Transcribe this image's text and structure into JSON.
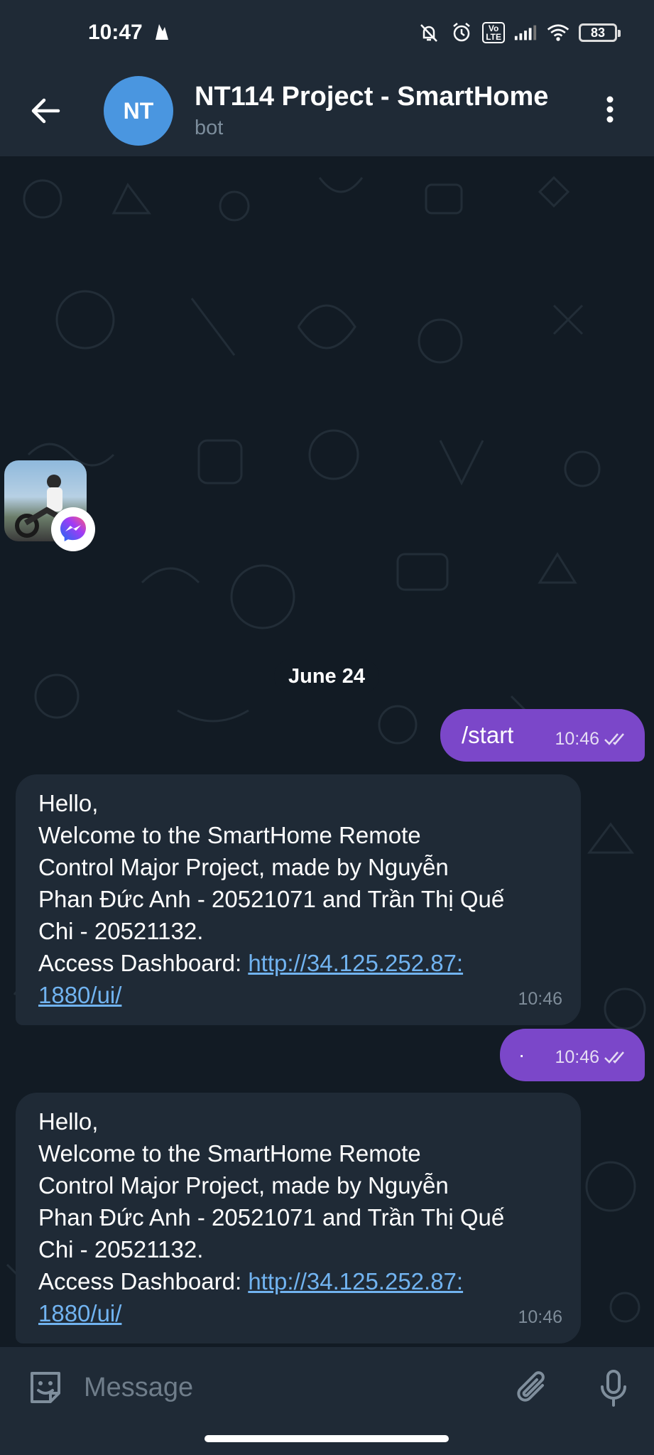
{
  "status_bar": {
    "time": "10:47",
    "battery": "83",
    "volte_label": "Vo\nLTE",
    "icons": [
      "firebase-icon",
      "bell-off-icon",
      "alarm-icon",
      "volte-icon",
      "signal-icon",
      "wifi-icon",
      "battery-icon"
    ]
  },
  "header": {
    "avatar_initials": "NT",
    "title": "NT114 Project - SmartHome",
    "subtitle": "bot",
    "avatar_color": "#4a96e0"
  },
  "chat": {
    "date_separator": "June 24",
    "messages": [
      {
        "direction": "out",
        "text": "/start",
        "time": "10:46",
        "status": "read"
      },
      {
        "direction": "in",
        "lines": [
          "Hello,",
          "Welcome to the SmartHome Remote",
          "Control Major Project, made by Nguyễn",
          "Phan Đức Anh - 20521071 and Trần Thị Quế",
          "Chi - 20521132."
        ],
        "dashboard_label": "Access Dashboard: ",
        "link_part1": "http://34.125.252.87:",
        "link_part2": "1880/ui/",
        "time": "10:46"
      },
      {
        "direction": "out",
        "text": "·",
        "time": "10:46",
        "status": "read"
      },
      {
        "direction": "in",
        "lines": [
          "Hello,",
          "Welcome to the SmartHome Remote",
          "Control Major Project, made by Nguyễn",
          "Phan Đức Anh - 20521071 and Trần Thị Quế",
          "Chi - 20521132."
        ],
        "dashboard_label": "Access Dashboard: ",
        "link_part1": "http://34.125.252.87:",
        "link_part2": "1880/ui/",
        "time": "10:46"
      }
    ]
  },
  "input": {
    "placeholder": "Message"
  },
  "colors": {
    "outgoing_bubble": "#7b47c9",
    "incoming_bubble": "#1f2a36",
    "background": "#121b24",
    "link": "#71b3f0"
  }
}
